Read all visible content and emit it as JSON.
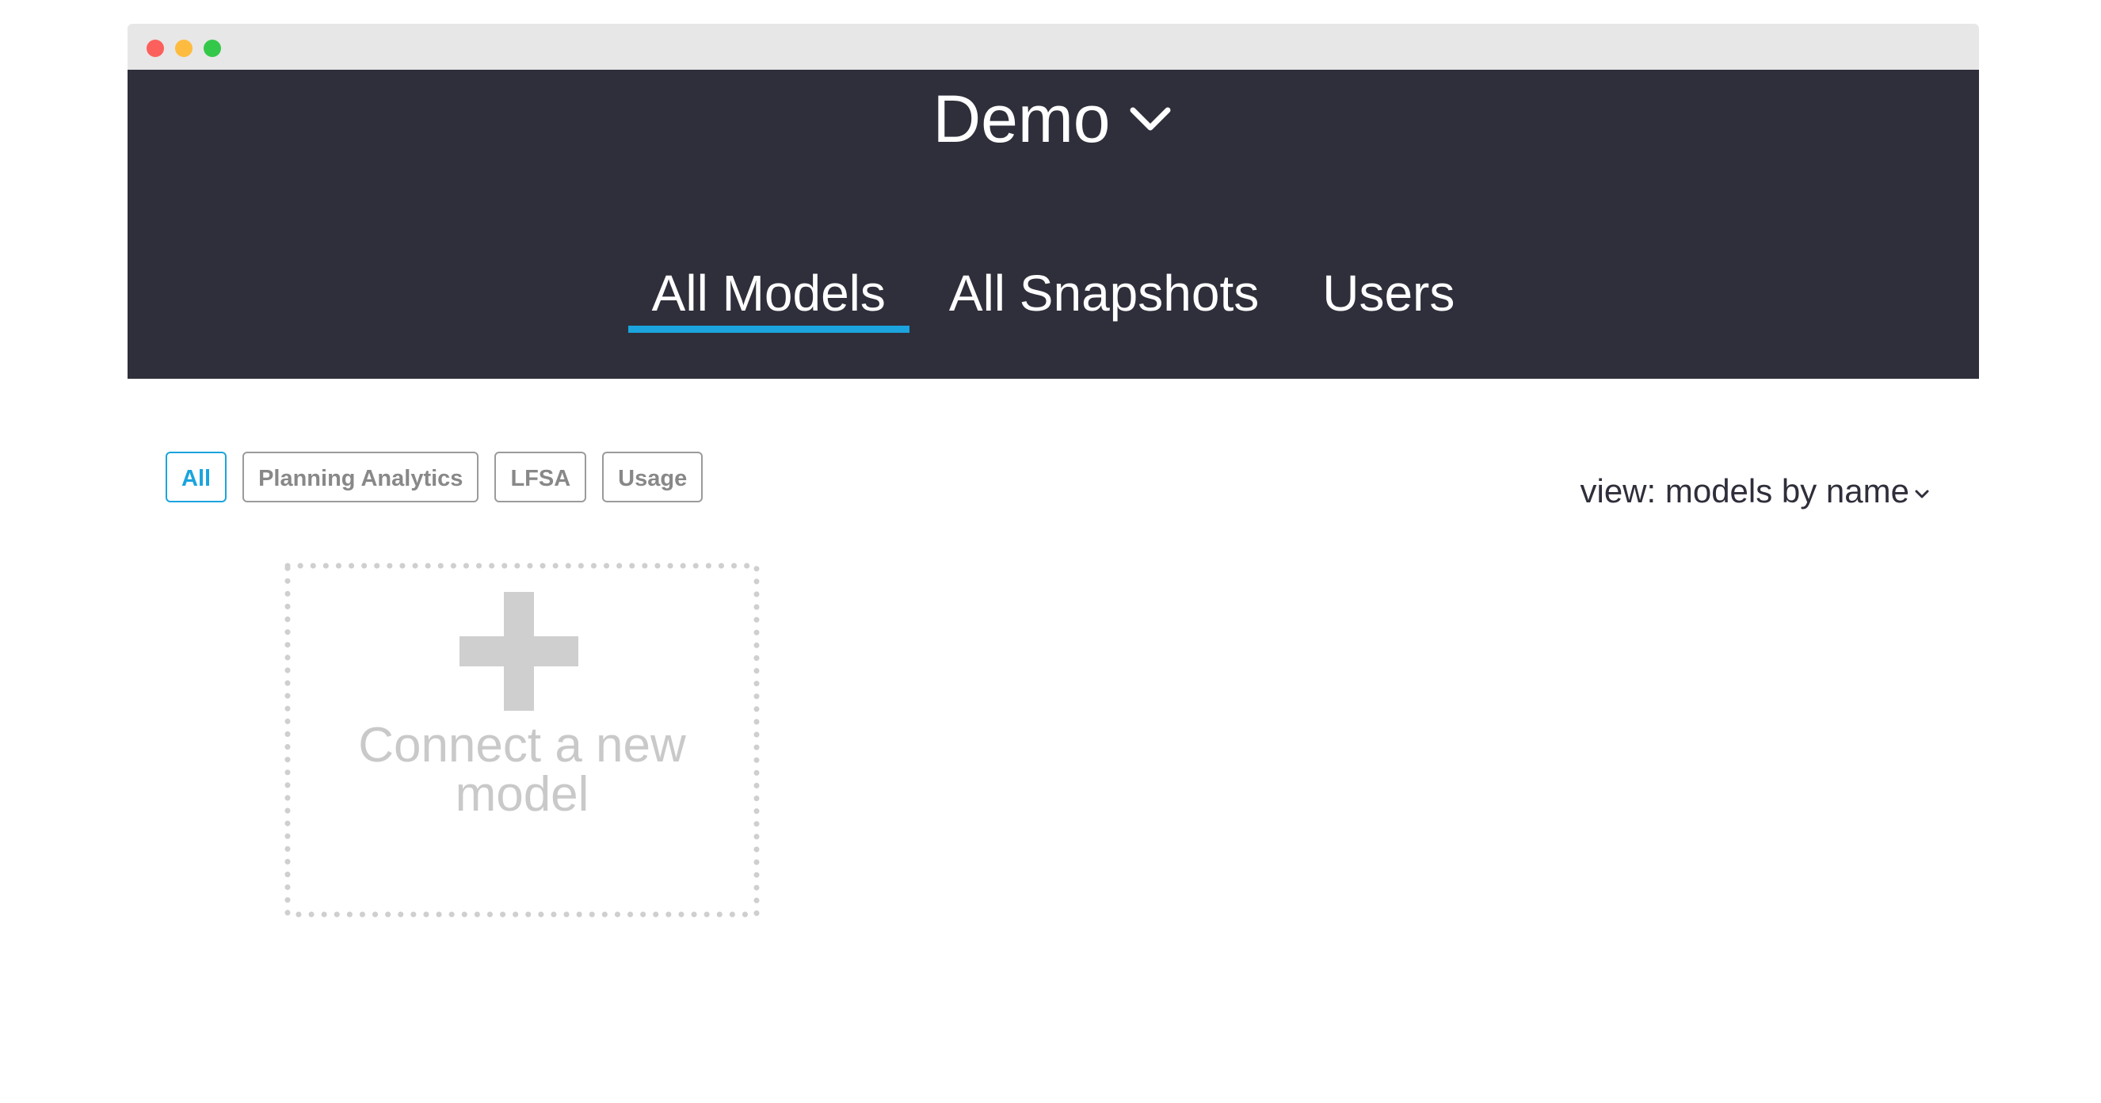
{
  "window": {
    "controls": [
      "close",
      "minimize",
      "maximize"
    ]
  },
  "header": {
    "workspace_name": "Demo",
    "workspace_icon": "chevron-down-icon"
  },
  "tabs": [
    {
      "label": "All Models",
      "active": true
    },
    {
      "label": "All Snapshots",
      "active": false
    },
    {
      "label": "Users",
      "active": false
    }
  ],
  "filters": [
    {
      "label": "All",
      "active": true
    },
    {
      "label": "Planning Analytics",
      "active": false
    },
    {
      "label": "LFSA",
      "active": false
    },
    {
      "label": "Usage",
      "active": false
    }
  ],
  "view_selector": {
    "label": "view: models by name"
  },
  "new_model_card": {
    "label_line1": "Connect a new",
    "label_line2": "model",
    "icon": "plus-icon"
  },
  "colors": {
    "header_bg": "#2f2f3b",
    "accent": "#1ba4de",
    "card_muted": "#c9c9c9"
  }
}
